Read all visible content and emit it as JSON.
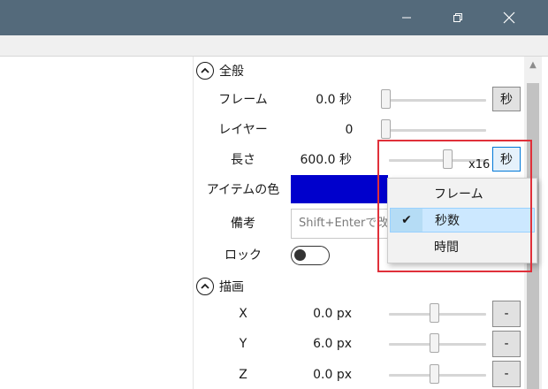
{
  "window": {
    "minimize_icon": "minimize-icon",
    "maximize_icon": "restore-icon",
    "close_icon": "close-icon"
  },
  "colors": {
    "titlebar": "#546a7b",
    "item_color": "#0000cc",
    "highlight": "#e0303a"
  },
  "sections": {
    "general": {
      "title": "全般",
      "toggle_icon": "chevron-up-icon"
    },
    "drawing": {
      "title": "描画",
      "toggle_icon": "chevron-up-icon"
    }
  },
  "general": {
    "frame": {
      "label": "フレーム",
      "value": "0.0 秒",
      "unit_button": "秒"
    },
    "layer": {
      "label": "レイヤー",
      "value": "0"
    },
    "length": {
      "label": "長さ",
      "value": "600.0 秒",
      "unit_button": "秒",
      "multiplier": "x16"
    },
    "item_color": {
      "label": "アイテムの色"
    },
    "memo": {
      "label": "備考",
      "placeholder": "Shift+Enterで改行"
    },
    "lock": {
      "label": "ロック",
      "checked": false
    }
  },
  "unit_menu": {
    "items": [
      {
        "label": "フレーム",
        "checked": false
      },
      {
        "label": "秒数",
        "checked": true,
        "check_mark": "✔"
      },
      {
        "label": "時間",
        "checked": false
      }
    ]
  },
  "drawing": {
    "x": {
      "label": "X",
      "value": "0.0 px",
      "button": "-"
    },
    "y": {
      "label": "Y",
      "value": "6.0 px",
      "button": "-"
    },
    "z": {
      "label": "Z",
      "value": "0.0 px",
      "button": "-"
    }
  }
}
